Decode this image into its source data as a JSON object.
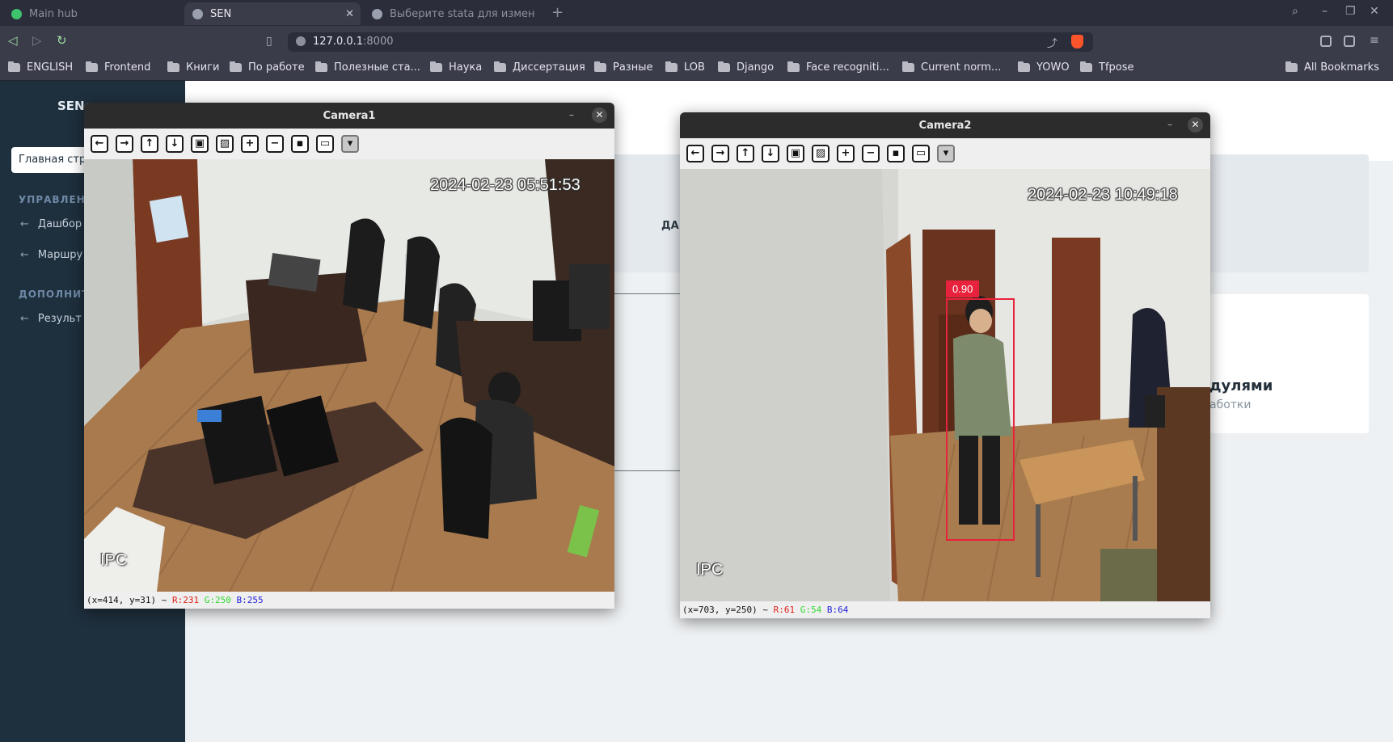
{
  "browser": {
    "tabs": [
      {
        "title": "Main hub",
        "active": false,
        "favicon": "check-circle-icon"
      },
      {
        "title": "SEN",
        "active": true,
        "favicon": "globe-icon"
      },
      {
        "title": "Выберите stata для измене",
        "active": false,
        "favicon": "globe-icon"
      }
    ],
    "url_host": "127.0.0.1",
    "url_port": ":8000",
    "bookmarks": [
      "ENGLISH",
      "Frontend",
      "Книги",
      "По работе",
      "Полезные ста...",
      "Наука",
      "Диссертация",
      "Разные",
      "LOB",
      "Django",
      "Face recogniti...",
      "Current norm...",
      "YOWO",
      "Tfpose"
    ],
    "all_bookmarks": "All Bookmarks"
  },
  "page": {
    "brand": "SEN",
    "home_item": "Главная стр",
    "section_manage": "УПРАВЛЕНИ",
    "item_dashboard": "Дашбор",
    "item_routes": "Маршру",
    "section_extra": "ДОПОЛНИТЕ",
    "item_results": "Результ",
    "card1_text": "ДА",
    "card2_title": "дулями",
    "card2_sub": "аботки"
  },
  "camera1": {
    "title": "Camera1",
    "timestamp": "2024-02-23 05:51:53",
    "osd": "IPC",
    "status_coords": "(x=414, y=31) ~",
    "status_r": "R:231",
    "status_g": "G:250",
    "status_b": "B:255"
  },
  "camera2": {
    "title": "Camera2",
    "timestamp": "2024-02-23 10:49:18",
    "osd": "IPC",
    "detection_score": "0.90",
    "status_coords": "(x=703, y=250) ~",
    "status_r": "R:61",
    "status_g": "G:54",
    "status_b": "B:64"
  },
  "cv_tools": [
    "arrow-left-icon",
    "arrow-right-icon",
    "arrow-up-icon",
    "arrow-down-icon",
    "zoom-fit-icon",
    "image-icon",
    "zoom-in-icon",
    "zoom-out-icon",
    "save-icon",
    "copy-icon",
    "properties-icon"
  ],
  "colors": {
    "detection": "#e8223c",
    "sidebar": "#1e2f3d",
    "brave": "#fb542b"
  }
}
